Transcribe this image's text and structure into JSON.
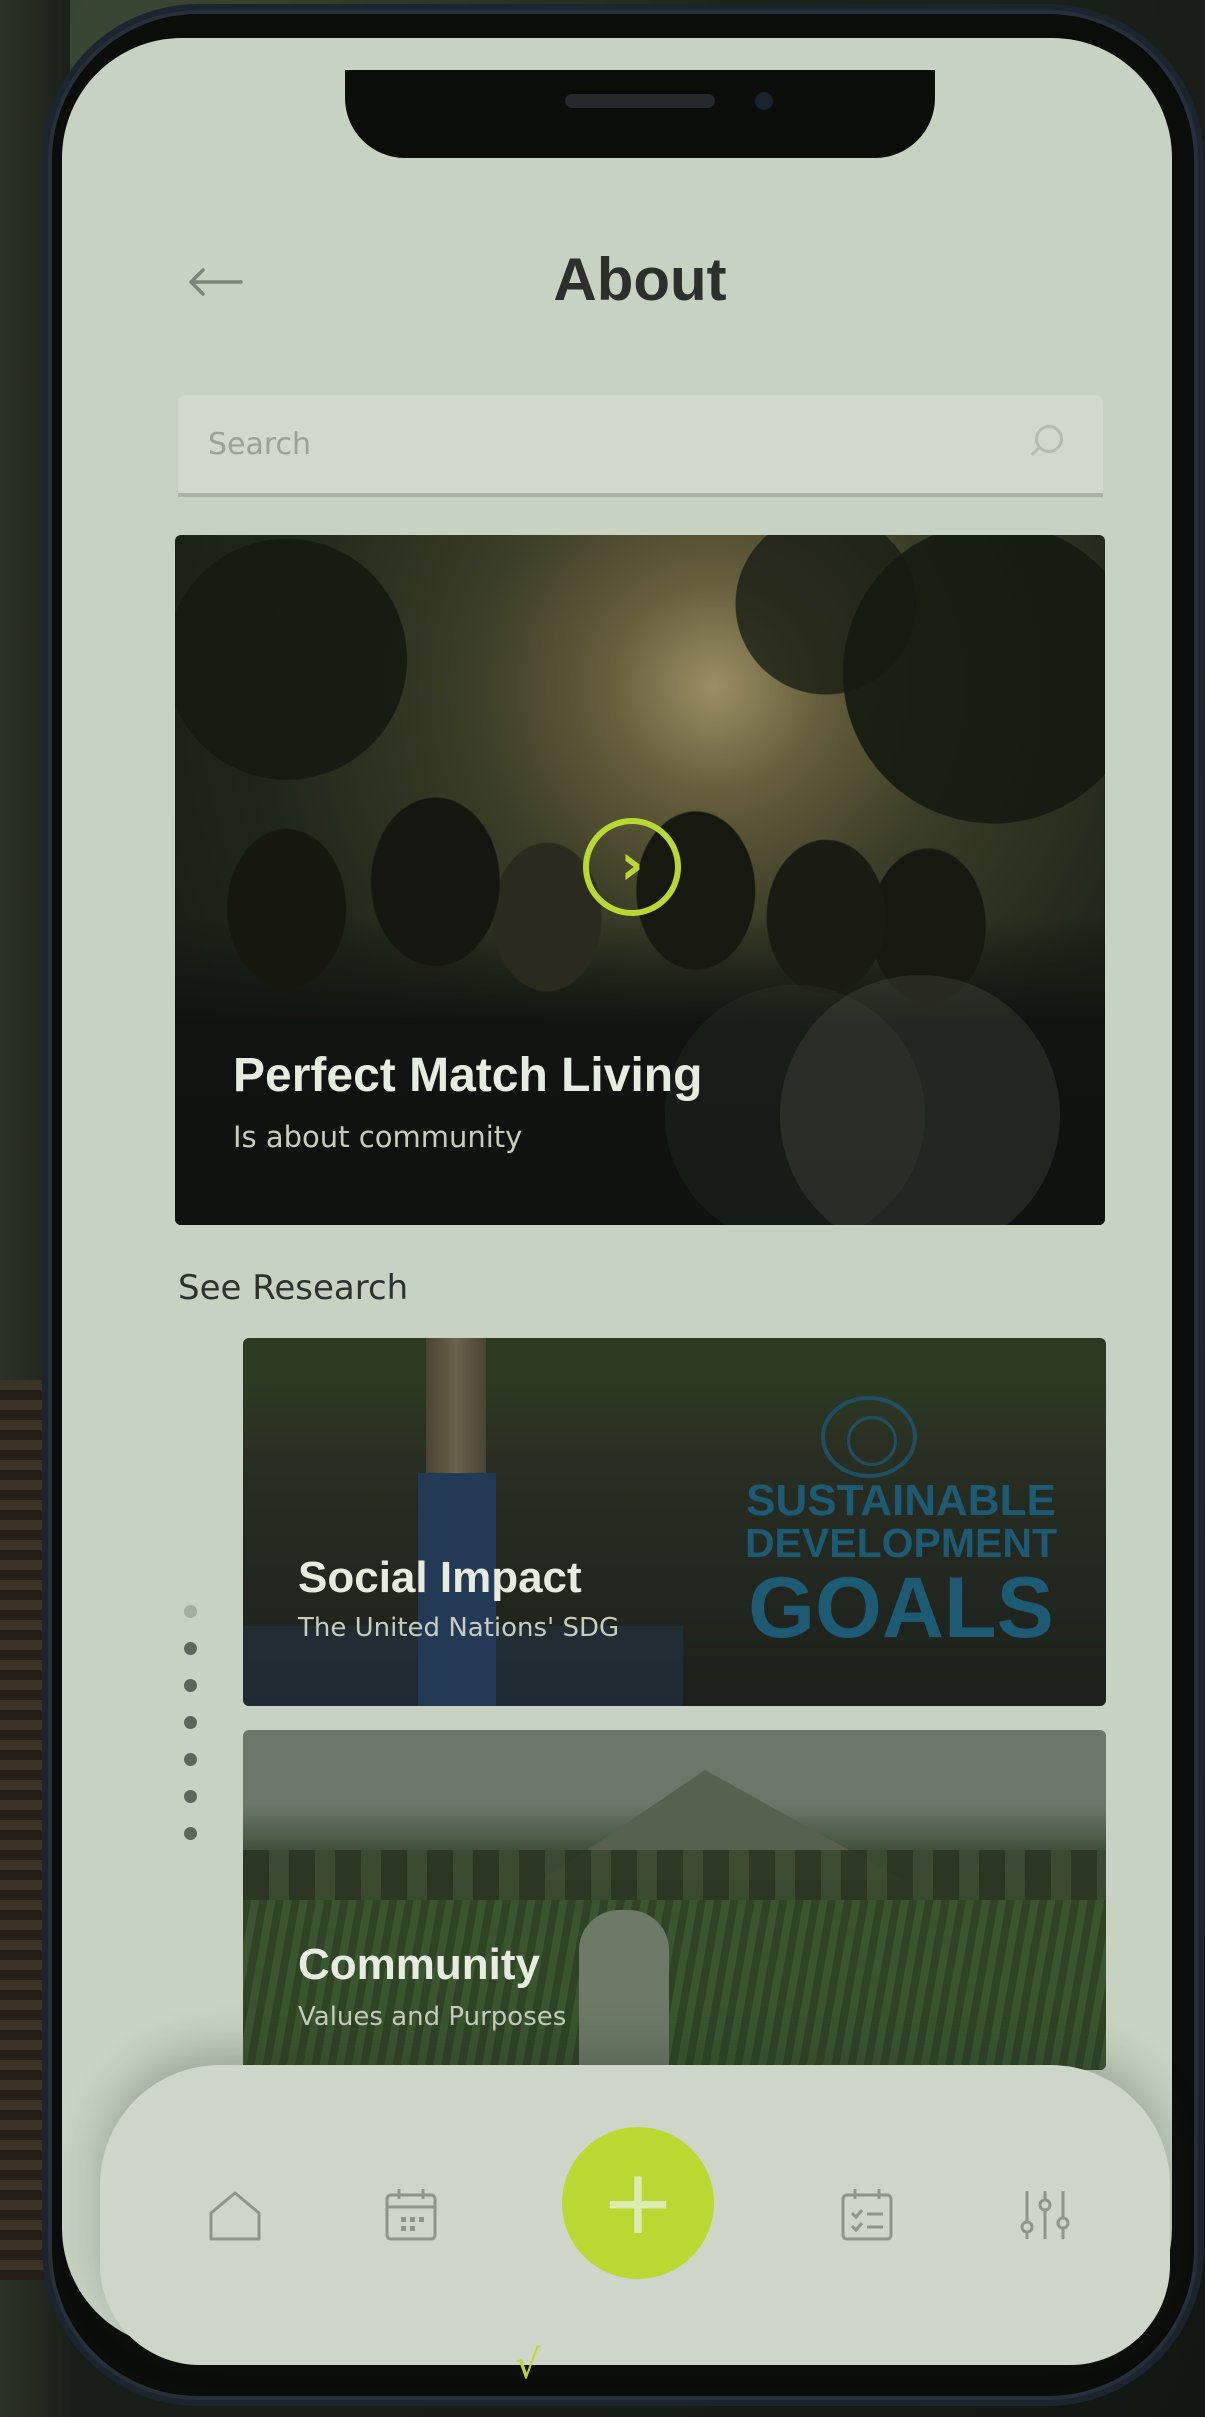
{
  "header": {
    "back_icon": "arrow-left-icon",
    "title": "About"
  },
  "search": {
    "placeholder": "Search",
    "icon": "search-icon"
  },
  "hero": {
    "title": "Perfect Match Living",
    "subtitle": "Is about community",
    "play_icon": "chevron-right-icon"
  },
  "research": {
    "section_label": "See Research",
    "cards": [
      {
        "title": "Social Impact",
        "subtitle": "The United Nations' SDG",
        "logo_lines": [
          "SUSTAINABLE",
          "DEVELOPMENT",
          "GOALS"
        ]
      },
      {
        "title": "Community",
        "subtitle": "Values and Purposes"
      }
    ],
    "dots_total": 7,
    "dot_active": 1
  },
  "nav": {
    "items": [
      {
        "icon": "home-icon"
      },
      {
        "icon": "calendar-icon"
      },
      {
        "icon": "plus-icon",
        "label": "+"
      },
      {
        "icon": "checklist-calendar-icon"
      },
      {
        "icon": "sliders-icon"
      }
    ]
  },
  "colors": {
    "accent": "#b9d832",
    "screen_bg": "#c8d2c3",
    "title_text": "#2b302b"
  }
}
